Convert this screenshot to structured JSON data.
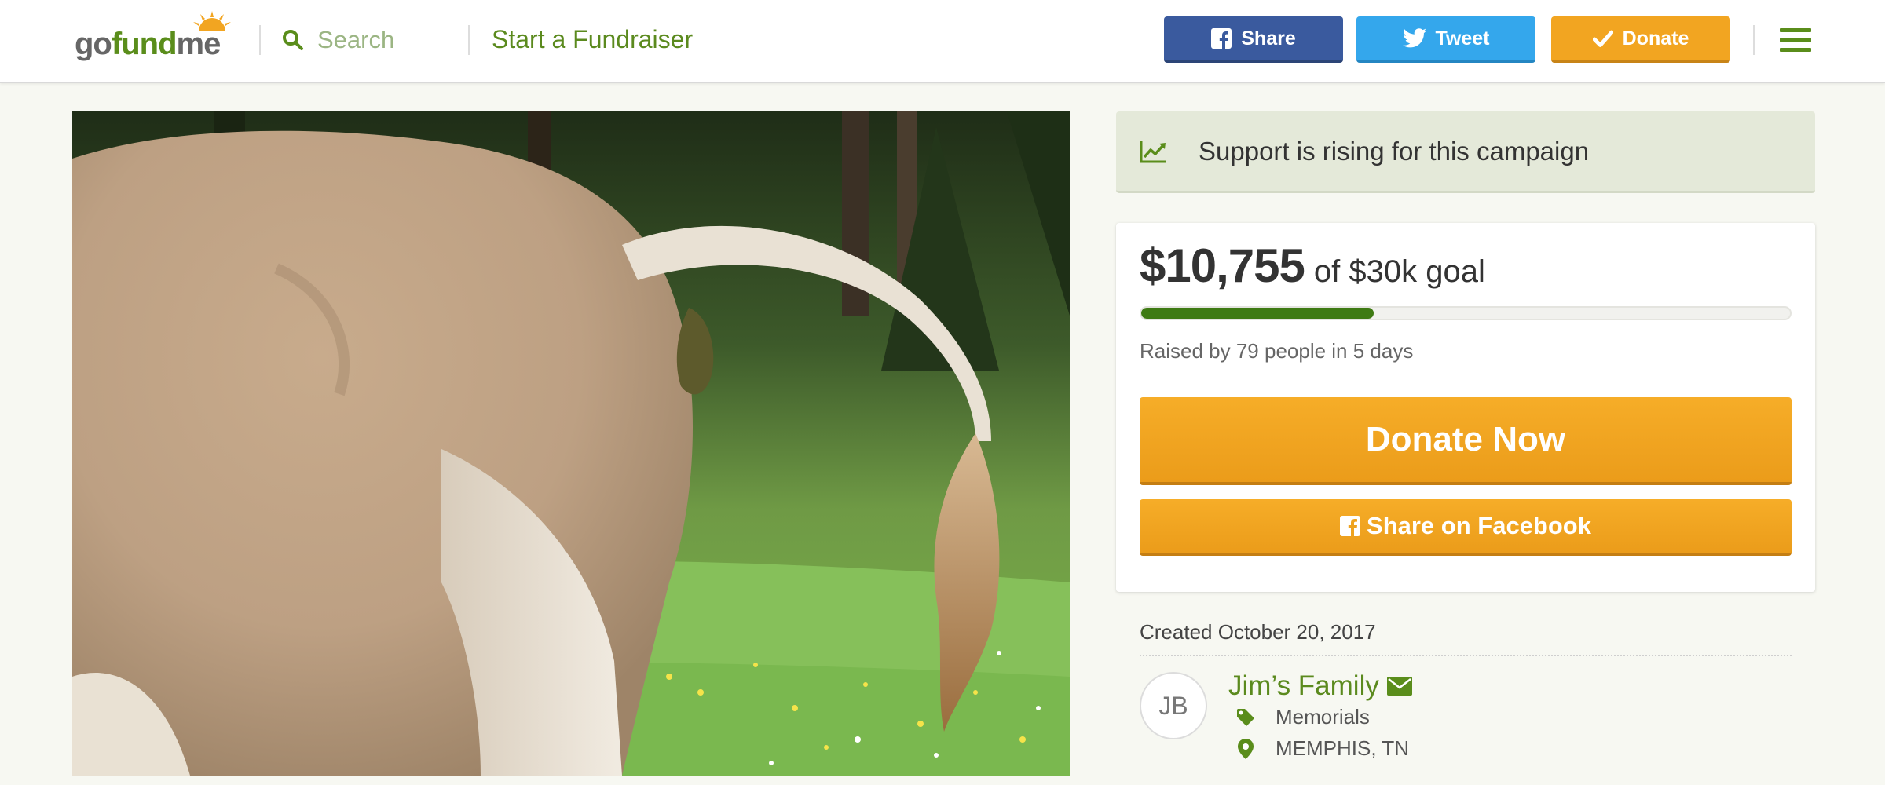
{
  "header": {
    "logo": {
      "go": "go",
      "fund": "fund",
      "me": "me"
    },
    "search_placeholder": "Search",
    "start_link": "Start a Fundraiser",
    "share_label": "Share",
    "tweet_label": "Tweet",
    "donate_label": "Donate"
  },
  "colors": {
    "brand_green": "#5a8d1b",
    "facebook_blue": "#3a5a9e",
    "twitter_blue": "#34a7ec",
    "donate_orange": "#f2a521",
    "progress_green": "#3e7a13"
  },
  "campaign": {
    "rising_text": "Support is rising for this campaign",
    "amount_raised": "$10,755",
    "goal_text": "of $30k goal",
    "progress_fraction": 0.358,
    "raised_by": "Raised by 79 people in 5 days",
    "donate_now_label": "Donate Now",
    "share_facebook_label": "Share on Facebook",
    "created": "Created October 20, 2017",
    "organizer_initials": "JB",
    "organizer_name": "Jim’s Family",
    "category": "Memorials",
    "location": "MEMPHIS, TN"
  },
  "icons": {
    "search": "search-icon",
    "facebook": "facebook-icon",
    "twitter": "twitter-icon",
    "check": "check-icon",
    "menu": "hamburger-menu-icon",
    "trend": "trending-up-icon",
    "envelope": "envelope-icon",
    "tag": "tag-icon",
    "location": "map-pin-icon"
  }
}
